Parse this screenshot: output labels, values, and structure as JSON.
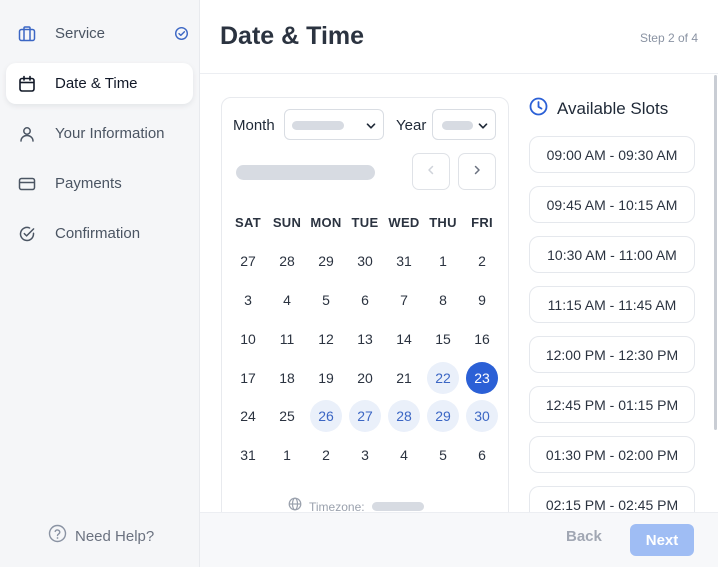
{
  "sidebar": {
    "items": [
      {
        "label": "Service",
        "icon": "briefcase-icon",
        "status": "completed"
      },
      {
        "label": "Date & Time",
        "icon": "calendar-icon",
        "status": "active"
      },
      {
        "label": "Your Information",
        "icon": "user-icon",
        "status": "pending"
      },
      {
        "label": "Payments",
        "icon": "credit-card-icon",
        "status": "pending"
      },
      {
        "label": "Confirmation",
        "icon": "check-circle-icon",
        "status": "pending"
      }
    ],
    "help_label": "Need Help?"
  },
  "header": {
    "title": "Date & Time",
    "step": "Step 2 of 4"
  },
  "calendar": {
    "month_label": "Month",
    "year_label": "Year",
    "weekdays": [
      "SAT",
      "SUN",
      "MON",
      "TUE",
      "WED",
      "THU",
      "FRI"
    ],
    "weeks": [
      [
        "27",
        "28",
        "29",
        "30",
        "31",
        "1",
        "2"
      ],
      [
        "3",
        "4",
        "5",
        "6",
        "7",
        "8",
        "9"
      ],
      [
        "10",
        "11",
        "12",
        "13",
        "14",
        "15",
        "16"
      ],
      [
        "17",
        "18",
        "19",
        "20",
        "21",
        "22",
        "23"
      ],
      [
        "24",
        "25",
        "26",
        "27",
        "28",
        "29",
        "30"
      ],
      [
        "31",
        "1",
        "2",
        "3",
        "4",
        "5",
        "6"
      ]
    ],
    "available_days": [
      "22",
      "26",
      "27",
      "28",
      "29",
      "30"
    ],
    "selected_day": "23",
    "timezone_label": "Timezone:"
  },
  "slots": {
    "title": "Available Slots",
    "items": [
      "09:00 AM - 09:30 AM",
      "09:45 AM - 10:15 AM",
      "10:30 AM - 11:00 AM",
      "11:15 AM - 11:45 AM",
      "12:00 PM - 12:30 PM",
      "12:45 PM - 01:15 PM",
      "01:30 PM - 02:00 PM",
      "02:15 PM - 02:45 PM"
    ]
  },
  "footer": {
    "back_label": "Back",
    "next_label": "Next"
  },
  "colors": {
    "accent": "#2b60d6",
    "accent_soft": "#eaf0fa",
    "next_disabled": "#9fbdf4"
  }
}
